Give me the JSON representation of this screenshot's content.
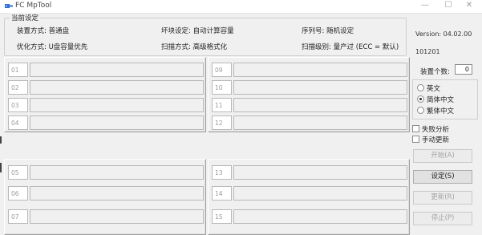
{
  "window": {
    "title": "FC MpTool",
    "minimize_glyph": "—",
    "maximize_glyph": "☐",
    "close_glyph": "✕"
  },
  "current_settings": {
    "title": "当前设定",
    "install_mode": "装置方式: 普通盘",
    "bad_block": "坏块设定: 自动计算容量",
    "serial": "序列号: 随机设定",
    "optimize": "优化方式: U盘容量优先",
    "scan_mode": "扫描方式: 高级格式化",
    "scan_level": "扫描级别: 量产过 (ECC = 默认)"
  },
  "ports": [
    "01",
    "02",
    "03",
    "04",
    "05",
    "06",
    "07",
    "09",
    "10",
    "11",
    "12",
    "13",
    "14",
    "15"
  ],
  "side": {
    "version": "Version: 04.02.00",
    "serial_code": "101201",
    "device_count_label": "装置个数:",
    "device_count": "0",
    "languages": [
      {
        "label": "英文",
        "selected": false
      },
      {
        "label": "简体中文",
        "selected": true
      },
      {
        "label": "繁体中文",
        "selected": false
      }
    ],
    "checkboxes": [
      {
        "label": "失败分析",
        "checked": false
      },
      {
        "label": "手动更新",
        "checked": false
      }
    ],
    "buttons": {
      "start": "开始(A)",
      "settings": "设定(S)",
      "update": "更新(R)",
      "stop": "停止(P)"
    }
  },
  "colors": {
    "background": "#f0f0f0",
    "panel_border": "#a0a0a0",
    "disabled_text": "#a3a3a3"
  }
}
